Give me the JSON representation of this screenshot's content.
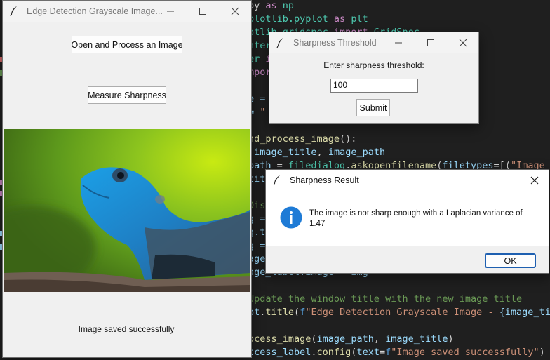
{
  "editor": {
    "lines": [
      {
        "parts": [
          {
            "t": "by ",
            "c": ""
          },
          {
            "t": "as",
            "c": "kw"
          },
          {
            "t": " np",
            "c": "mod"
          }
        ]
      },
      {
        "parts": [
          {
            "t": "plotlib.pyplot ",
            "c": "mod"
          },
          {
            "t": "as",
            "c": "kw"
          },
          {
            "t": " plt",
            "c": "mod"
          }
        ]
      },
      {
        "parts": [
          {
            "t": "otlib.gridspec ",
            "c": "mod"
          },
          {
            "t": "import",
            "c": "kw"
          },
          {
            "t": " GridSpec",
            "c": "mod"
          }
        ]
      },
      {
        "parts": [
          {
            "t": "nter",
            "c": "mod"
          }
        ]
      },
      {
        "parts": [
          {
            "t": "er ",
            "c": "mod"
          },
          {
            "t": "i",
            "c": "kw"
          }
        ]
      },
      {
        "parts": [
          {
            "t": "mpor",
            "c": "kw"
          }
        ]
      },
      {
        "parts": [
          {
            "t": "",
            "c": ""
          }
        ]
      },
      {
        "parts": [
          {
            "t": "e =",
            "c": "var"
          }
        ]
      },
      {
        "parts": [
          {
            "t": "= ",
            "c": "var"
          },
          {
            "t": "\"",
            "c": "str"
          }
        ]
      },
      {
        "parts": [
          {
            "t": "",
            "c": ""
          }
        ]
      },
      {
        "parts": [
          {
            "t": "nd_process_image",
            "c": "fn"
          },
          {
            "t": "():",
            "c": ""
          }
        ]
      },
      {
        "parts": [
          {
            "t": " image_title",
            "c": "var"
          },
          {
            "t": ", ",
            "c": ""
          },
          {
            "t": "image_path",
            "c": "var"
          }
        ]
      },
      {
        "parts": [
          {
            "t": "path",
            "c": "var"
          },
          {
            "t": " = ",
            "c": ""
          },
          {
            "t": "filedialog",
            "c": "mod"
          },
          {
            "t": ".",
            "c": ""
          },
          {
            "t": "askopenfilename",
            "c": "fn"
          },
          {
            "t": "(",
            "c": ""
          },
          {
            "t": "filetypes",
            "c": "var"
          },
          {
            "t": "=[(",
            "c": ""
          },
          {
            "t": "\"Image fil",
            "c": "str"
          }
        ]
      },
      {
        "parts": [
          {
            "t": "tit",
            "c": "var"
          }
        ]
      },
      {
        "parts": [
          {
            "t": "",
            "c": ""
          }
        ]
      },
      {
        "parts": [
          {
            "t": "Dis",
            "c": "cmt"
          }
        ]
      },
      {
        "parts": [
          {
            "t": "g =",
            "c": "var"
          }
        ]
      },
      {
        "parts": [
          {
            "t": "g.t",
            "c": "var"
          }
        ]
      },
      {
        "parts": [
          {
            "t": "g =",
            "c": "var"
          }
        ]
      },
      {
        "parts": [
          {
            "t": "age",
            "c": "var"
          }
        ]
      },
      {
        "parts": [
          {
            "t": "age_label.image",
            "c": "var"
          },
          {
            "t": " = ",
            "c": ""
          },
          {
            "t": "img",
            "c": "var"
          }
        ]
      },
      {
        "parts": [
          {
            "t": "",
            "c": ""
          }
        ]
      },
      {
        "parts": [
          {
            "t": "Update the window title with the new image title",
            "c": "cmt"
          }
        ]
      },
      {
        "parts": [
          {
            "t": "ot",
            "c": "var"
          },
          {
            "t": ".",
            "c": ""
          },
          {
            "t": "title",
            "c": "fn"
          },
          {
            "t": "(",
            "c": ""
          },
          {
            "t": "f",
            "c": "blu"
          },
          {
            "t": "\"Edge Detection Grayscale Image - ",
            "c": "str"
          },
          {
            "t": "{image_title",
            "c": "var"
          }
        ]
      },
      {
        "parts": [
          {
            "t": "",
            "c": ""
          }
        ]
      },
      {
        "parts": [
          {
            "t": "ocess_image",
            "c": "fn"
          },
          {
            "t": "(",
            "c": ""
          },
          {
            "t": "image_path",
            "c": "var"
          },
          {
            "t": ", ",
            "c": ""
          },
          {
            "t": "image_title",
            "c": "var"
          },
          {
            "t": ")",
            "c": ""
          }
        ]
      },
      {
        "parts": [
          {
            "t": "ccess_label",
            "c": "var"
          },
          {
            "t": ".",
            "c": ""
          },
          {
            "t": "config",
            "c": "fn"
          },
          {
            "t": "(",
            "c": ""
          },
          {
            "t": "text",
            "c": "var"
          },
          {
            "t": "=",
            "c": ""
          },
          {
            "t": "f",
            "c": "blu"
          },
          {
            "t": "\"Image saved successfully\"",
            "c": "str"
          },
          {
            "t": ")",
            "c": ""
          }
        ]
      }
    ]
  },
  "main_window": {
    "title": "Edge Detection Grayscale Image...",
    "open_button": "Open and Process an Image",
    "measure_button": "Measure Sharpness",
    "status": "Image saved successfully"
  },
  "threshold_dialog": {
    "title": "Sharpness Threshold",
    "prompt": "Enter sharpness threshold:",
    "input_value": "100",
    "submit_button": "Submit"
  },
  "result_dialog": {
    "title": "Sharpness Result",
    "message": "The image is not sharp enough with a Laplacian variance of 1.47",
    "ok_button": "OK"
  },
  "colors": {
    "editor_bg": "#1f1f1f",
    "dialog_bg": "#f0f0f0",
    "info_icon": "#1e7bd6",
    "lizard_body": "#2a8fd6",
    "background_green": "#9acd20"
  },
  "icons": [
    "feather-icon",
    "minimize-icon",
    "maximize-icon",
    "close-icon",
    "info-icon"
  ]
}
